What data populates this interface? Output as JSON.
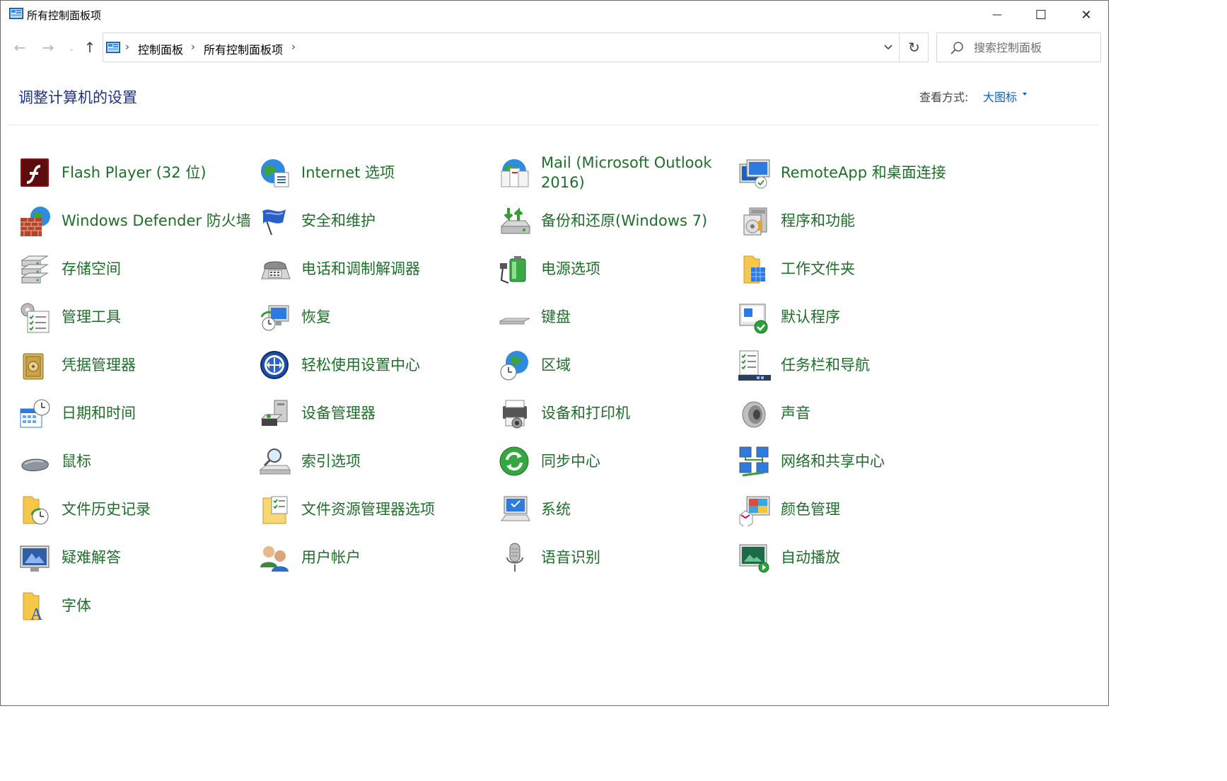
{
  "window": {
    "title": "所有控制面板项",
    "controls": {
      "minimize": "—",
      "maximize": "☐",
      "close": "✕"
    }
  },
  "address": {
    "breadcrumbs": [
      "控制面板",
      "所有控制面板项"
    ],
    "search_placeholder": "搜索控制面板"
  },
  "header": {
    "title": "调整计算机的设置",
    "view_label": "查看方式:",
    "view_value": "大图标"
  },
  "items": [
    {
      "label": "Flash Player (32 位)",
      "icon": "flash-icon"
    },
    {
      "label": "Internet 选项",
      "icon": "internet-options-icon"
    },
    {
      "label": "Mail (Microsoft Outlook 2016)",
      "icon": "mail-icon"
    },
    {
      "label": "RemoteApp 和桌面连接",
      "icon": "remoteapp-icon"
    },
    {
      "label": "Windows Defender 防火墙",
      "icon": "firewall-icon"
    },
    {
      "label": "安全和维护",
      "icon": "security-flag-icon"
    },
    {
      "label": "备份和还原(Windows 7)",
      "icon": "backup-icon"
    },
    {
      "label": "程序和功能",
      "icon": "programs-icon"
    },
    {
      "label": "存储空间",
      "icon": "storage-icon"
    },
    {
      "label": "电话和调制解调器",
      "icon": "phone-modem-icon"
    },
    {
      "label": "电源选项",
      "icon": "power-icon"
    },
    {
      "label": "工作文件夹",
      "icon": "work-folders-icon"
    },
    {
      "label": "管理工具",
      "icon": "admin-tools-icon"
    },
    {
      "label": "恢复",
      "icon": "recovery-icon"
    },
    {
      "label": "键盘",
      "icon": "keyboard-icon"
    },
    {
      "label": "默认程序",
      "icon": "default-programs-icon"
    },
    {
      "label": "凭据管理器",
      "icon": "credential-manager-icon"
    },
    {
      "label": "轻松使用设置中心",
      "icon": "ease-of-access-icon"
    },
    {
      "label": "区域",
      "icon": "region-icon"
    },
    {
      "label": "任务栏和导航",
      "icon": "taskbar-icon"
    },
    {
      "label": "日期和时间",
      "icon": "date-time-icon"
    },
    {
      "label": "设备管理器",
      "icon": "device-manager-icon"
    },
    {
      "label": "设备和打印机",
      "icon": "printer-icon"
    },
    {
      "label": "声音",
      "icon": "sound-icon"
    },
    {
      "label": "鼠标",
      "icon": "mouse-icon"
    },
    {
      "label": "索引选项",
      "icon": "indexing-icon"
    },
    {
      "label": "同步中心",
      "icon": "sync-icon"
    },
    {
      "label": "网络和共享中心",
      "icon": "network-icon"
    },
    {
      "label": "文件历史记录",
      "icon": "file-history-icon"
    },
    {
      "label": "文件资源管理器选项",
      "icon": "explorer-options-icon"
    },
    {
      "label": "系统",
      "icon": "system-icon"
    },
    {
      "label": "颜色管理",
      "icon": "color-management-icon"
    },
    {
      "label": "疑难解答",
      "icon": "troubleshooting-icon"
    },
    {
      "label": "用户帐户",
      "icon": "user-accounts-icon"
    },
    {
      "label": "语音识别",
      "icon": "speech-icon"
    },
    {
      "label": "自动播放",
      "icon": "autoplay-icon"
    },
    {
      "label": "字体",
      "icon": "fonts-icon"
    }
  ]
}
